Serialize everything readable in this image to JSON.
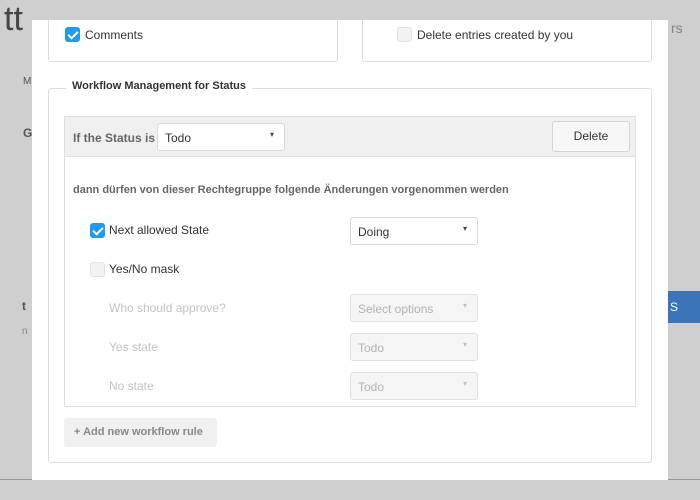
{
  "background": {
    "fragments": [
      "tt",
      "M",
      "G",
      "t",
      "n",
      "S",
      "rs"
    ]
  },
  "top_options": {
    "comments_label": "Comments",
    "comments_checked": true,
    "delete_own_label": "Delete entries created by you",
    "delete_own_checked": false
  },
  "workflow": {
    "legend": "Workflow Management for Status",
    "rule": {
      "status_label": "If the Status is",
      "status_value": "Todo",
      "delete_label": "Delete",
      "description": "dann dürfen von dieser Rechtegruppe folgende Änderungen vorgenommen werden",
      "next_state_label": "Next allowed State",
      "next_state_checked": true,
      "next_state_value": "Doing",
      "yesno_label": "Yes/No mask",
      "yesno_checked": false,
      "approve_label": "Who should approve?",
      "approve_placeholder": "Select options",
      "yes_state_label": "Yes state",
      "yes_state_value": "Todo",
      "no_state_label": "No state",
      "no_state_value": "Todo"
    },
    "add_rule_label": "+ Add new workflow rule"
  },
  "colors": {
    "accent": "#1e9bf0",
    "backdrop": "#cfcfcf"
  }
}
